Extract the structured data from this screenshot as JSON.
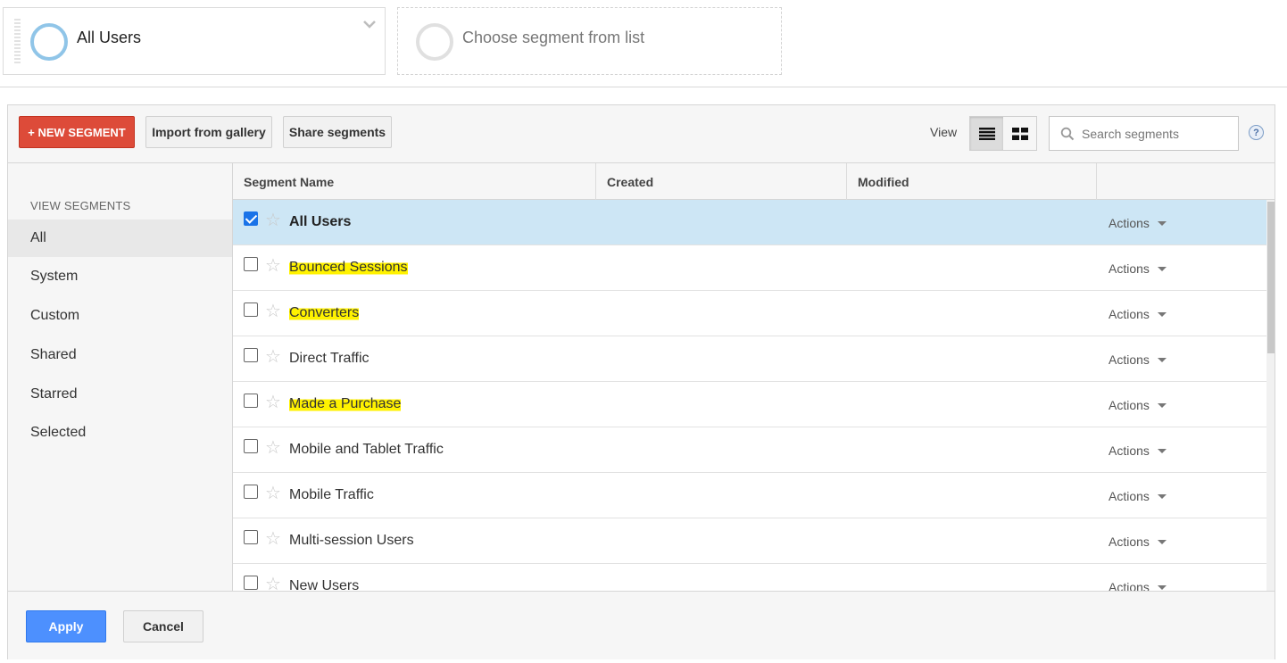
{
  "segments_bar": {
    "active_segment": "All Users",
    "empty_slot": "Choose segment from list"
  },
  "toolbar": {
    "new_segment": "+ NEW SEGMENT",
    "import": "Import from gallery",
    "share": "Share segments",
    "view_label": "View",
    "search_placeholder": "Search segments",
    "help": "?"
  },
  "sidenav": {
    "heading": "VIEW SEGMENTS",
    "items": [
      {
        "label": "All",
        "selected": true
      },
      {
        "label": "System"
      },
      {
        "label": "Custom"
      },
      {
        "label": "Shared"
      },
      {
        "label": "Starred"
      },
      {
        "label": "Selected"
      }
    ]
  },
  "table": {
    "columns": [
      "Segment Name",
      "Created",
      "Modified",
      ""
    ],
    "action_label": "Actions",
    "rows": [
      {
        "name": "All Users",
        "checked": true,
        "highlighted": false
      },
      {
        "name": "Bounced Sessions",
        "checked": false,
        "highlighted": true
      },
      {
        "name": "Converters",
        "checked": false,
        "highlighted": true
      },
      {
        "name": "Direct Traffic",
        "checked": false,
        "highlighted": false
      },
      {
        "name": "Made a Purchase",
        "checked": false,
        "highlighted": true
      },
      {
        "name": "Mobile and Tablet Traffic",
        "checked": false,
        "highlighted": false
      },
      {
        "name": "Mobile Traffic",
        "checked": false,
        "highlighted": false
      },
      {
        "name": "Multi-session Users",
        "checked": false,
        "highlighted": false
      },
      {
        "name": "New Users",
        "checked": false,
        "highlighted": false
      }
    ]
  },
  "footer": {
    "apply": "Apply",
    "cancel": "Cancel"
  },
  "colors": {
    "new_segment_bg": "#dd4b39",
    "apply_bg": "#4d90fe",
    "selected_row_bg": "#cde6f5",
    "highlight": "#fff200"
  }
}
